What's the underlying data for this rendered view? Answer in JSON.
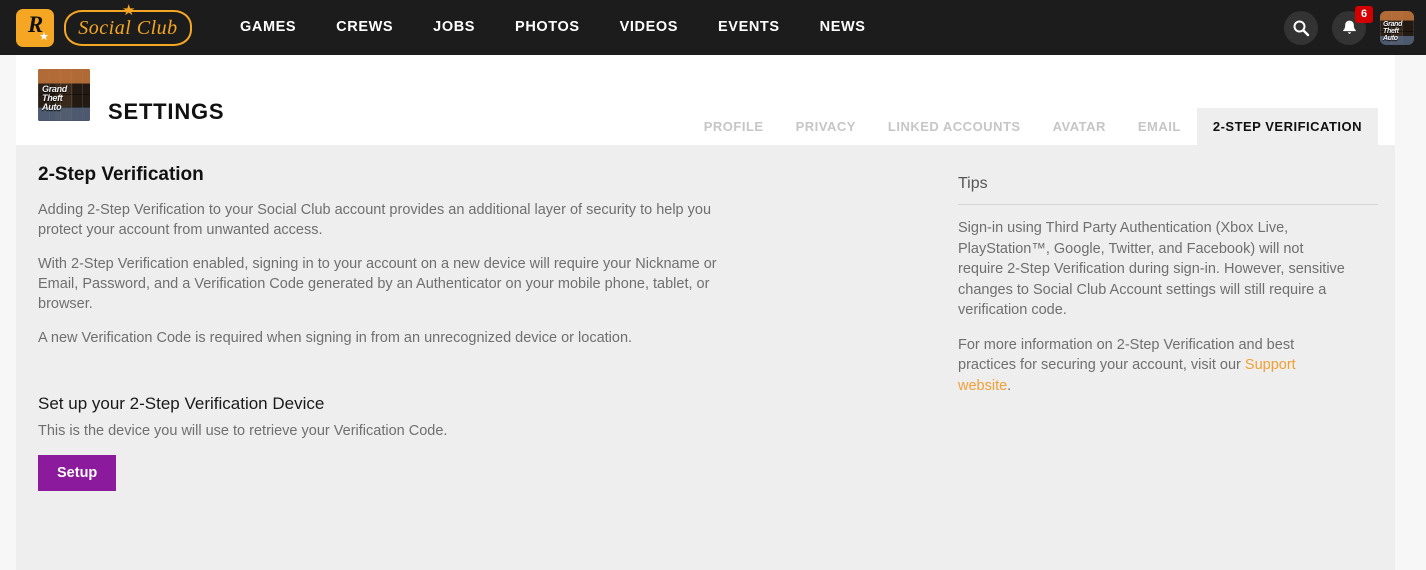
{
  "topnav": {
    "brand": {
      "rockstar_mark": "R",
      "rockstar_star": "★",
      "wordmark": "Social Club",
      "wordmark_star": "★"
    },
    "links": [
      {
        "label": "GAMES"
      },
      {
        "label": "CREWS"
      },
      {
        "label": "JOBS"
      },
      {
        "label": "PHOTOS"
      },
      {
        "label": "VIDEOS"
      },
      {
        "label": "EVENTS"
      },
      {
        "label": "NEWS"
      }
    ],
    "search_icon": "search-icon",
    "notifications": {
      "icon": "bell-icon",
      "count": "6",
      "badge_color": "#d40000"
    },
    "avatar": {
      "icon": "user-avatar",
      "art_label": "Grand Theft Auto V"
    },
    "background_color": "#1c1c1c",
    "brand_color": "#f5a623"
  },
  "settings_header": {
    "title": "SETTINGS",
    "avatar_art_label": "Grand Theft Auto V",
    "tabs": [
      {
        "label": "PROFILE",
        "active": false
      },
      {
        "label": "PRIVACY",
        "active": false
      },
      {
        "label": "LINKED ACCOUNTS",
        "active": false
      },
      {
        "label": "AVATAR",
        "active": false
      },
      {
        "label": "EMAIL",
        "active": false
      },
      {
        "label": "2-STEP VERIFICATION",
        "active": true
      }
    ]
  },
  "main": {
    "heading": "2-Step Verification",
    "paragraphs": [
      "Adding 2-Step Verification to your Social Club account provides an additional layer of security to help you protect your account from unwanted access.",
      "With 2-Step Verification enabled, signing in to your account on a new device will require your Nickname or Email, Password, and a Verification Code generated by an Authenticator on your mobile phone, tablet, or browser.",
      "A new Verification Code is required when signing in from an unrecognized device or location."
    ],
    "setup": {
      "heading": "Set up your 2-Step Verification Device",
      "subtext": "This is the device you will use to retrieve your Verification Code.",
      "button_label": "Setup",
      "button_color": "#8c1a9c"
    }
  },
  "tips": {
    "title": "Tips",
    "paragraph1": "Sign-in using Third Party Authentication (Xbox Live, PlayStation™, Google, Twitter, and Facebook) will not require 2-Step Verification during sign-in. However, sensitive changes to Social Club Account settings will still require a verification code.",
    "paragraph2_prefix": "For more information on 2-Step Verification and best practices for securing your account, visit our ",
    "paragraph2_link": "Support website",
    "paragraph2_suffix": ".",
    "link_color": "#f0a035"
  }
}
